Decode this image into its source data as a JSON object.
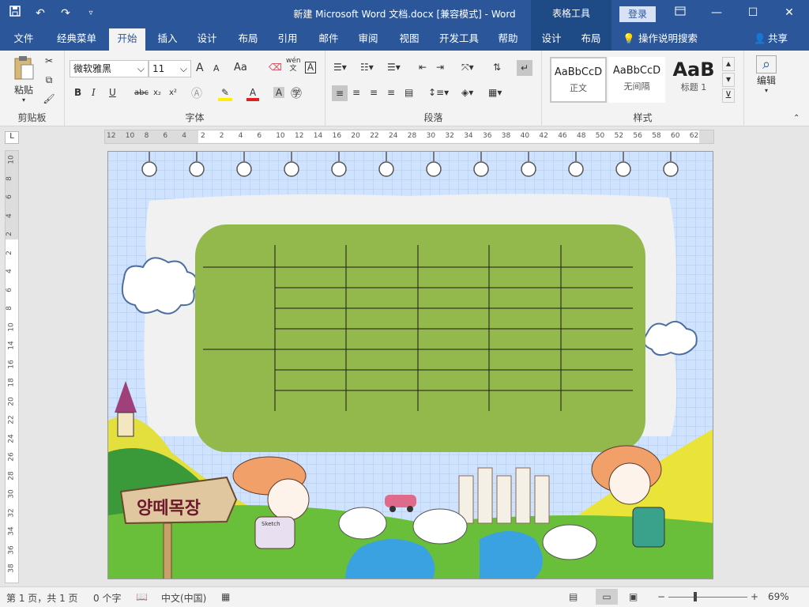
{
  "window": {
    "title": "新建 Microsoft Word 文档.docx [兼容模式]  -  Word",
    "context_tab_group": "表格工具",
    "login_label": "登录",
    "share_label": "共享",
    "tell_me": "操作说明搜索"
  },
  "tabs": [
    "文件",
    "经典菜单",
    "开始",
    "插入",
    "设计",
    "布局",
    "引用",
    "邮件",
    "审阅",
    "视图",
    "开发工具",
    "帮助",
    "设计",
    "布局"
  ],
  "active_tab": "开始",
  "ribbon": {
    "clipboard": {
      "paste_label": "粘贴",
      "group_label": "剪贴板"
    },
    "font": {
      "family": "微软雅黑",
      "size": "11",
      "group_label": "字体",
      "pinyin_glyph": "wén",
      "pinyin_char": "文",
      "case_glyph": "Aa",
      "size_up": "A",
      "size_down": "A"
    },
    "paragraph": {
      "group_label": "段落"
    },
    "styles": {
      "group_label": "样式",
      "items": [
        {
          "preview": "AaBbCcD",
          "name": "正文"
        },
        {
          "preview": "AaBbCcD",
          "name": "无间隔"
        },
        {
          "preview": "AaB",
          "name": "标题 1"
        }
      ]
    },
    "editing": {
      "label": "编辑"
    }
  },
  "ruler": {
    "h_ticks": [
      "12",
      "10",
      "8",
      "6",
      "4",
      "2",
      "2",
      "4",
      "6",
      "10",
      "12",
      "14",
      "16",
      "20",
      "22",
      "24",
      "28",
      "30",
      "32",
      "34",
      "36",
      "38",
      "40",
      "42",
      "46",
      "48",
      "50",
      "52",
      "56",
      "58",
      "60",
      "62"
    ],
    "v_ticks": [
      "10",
      "8",
      "6",
      "4",
      "2",
      "2",
      "4",
      "6",
      "8",
      "10",
      "14",
      "16",
      "18",
      "20",
      "22",
      "24",
      "26",
      "28",
      "30",
      "32",
      "34",
      "36",
      "38"
    ]
  },
  "document": {
    "banner_text": "양떼목장",
    "girl_label": "Sketch"
  },
  "status": {
    "page": "第 1 页，共 1 页",
    "words": "0 个字",
    "language": "中文(中国)",
    "zoom": "69%",
    "zoom_minus": "−",
    "zoom_plus": "+"
  }
}
